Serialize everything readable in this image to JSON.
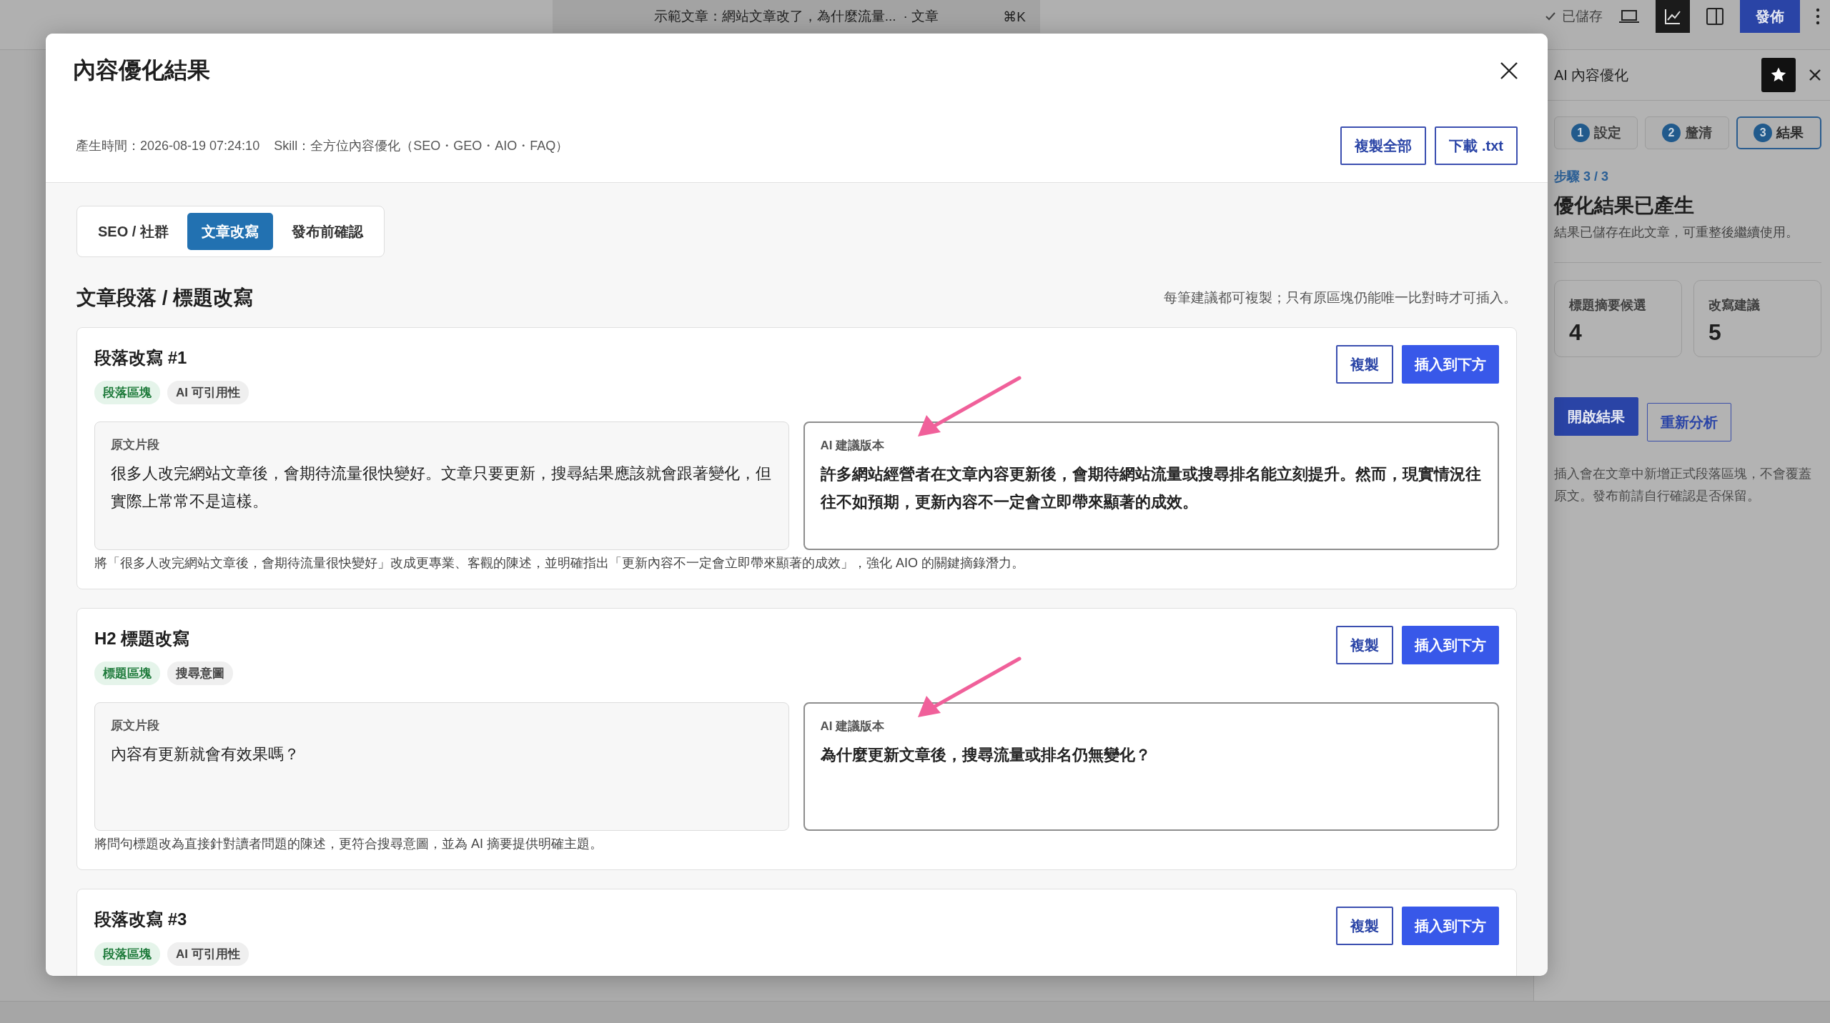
{
  "topbar": {
    "doc_title": "示範文章：網站文章改了，為什麼流量...",
    "doc_type": "· 文章",
    "shortcut": "⌘K",
    "saved": "已儲存",
    "publish": "發佈"
  },
  "sidebar": {
    "title": "AI 內容優化",
    "steps": [
      {
        "number": "1",
        "label": "設定",
        "selected": false
      },
      {
        "number": "2",
        "label": "釐清",
        "selected": false
      },
      {
        "number": "3",
        "label": "結果",
        "selected": true
      }
    ],
    "step_label": "步驟 3 / 3",
    "heading": "優化結果已產生",
    "subtext": "結果已儲存在此文章，可重整後繼續使用。",
    "stats": [
      {
        "label": "標題摘要候選",
        "value": "4"
      },
      {
        "label": "改寫建議",
        "value": "5"
      }
    ],
    "buttons": [
      {
        "label": "開啟結果",
        "kind": "primary"
      },
      {
        "label": "重新分析",
        "kind": "secondary"
      }
    ],
    "note": "插入會在文章中新增正式段落區塊，不會覆蓋原文。發布前請自行確認是否保留。"
  },
  "modal": {
    "title": "內容優化結果",
    "timestamp": "產生時間：2026-08-19 07:24:10",
    "skill": "Skill：全方位內容優化（SEO・GEO・AIO・FAQ）",
    "actions": [
      "複製全部",
      "下載 .txt"
    ],
    "tabs": [
      {
        "label": "SEO / 社群",
        "selected": false
      },
      {
        "label": "文章改寫",
        "selected": true
      },
      {
        "label": "發布前確認",
        "selected": false
      }
    ],
    "section_title": "文章段落 / 標題改寫",
    "section_note": "每筆建議都可複製；只有原區塊仍能唯一比對時才可插入。",
    "cards": [
      {
        "title": "段落改寫 #1",
        "tags": [
          {
            "label": "段落區塊",
            "kind": "block"
          },
          {
            "label": "AI 可引用性",
            "kind": "topic"
          }
        ],
        "copy": "複製",
        "insert": "插入到下方",
        "original_label": "原文片段",
        "original": "很多人改完網站文章後，會期待流量很快變好。文章只要更新，搜尋結果應該就會跟著變化，但實際上常常不是這樣。",
        "suggestion_label": "AI 建議版本",
        "suggestion": "許多網站經營者在文章內容更新後，會期待網站流量或搜尋排名能立刻提升。然而，現實情況往往不如預期，更新內容不一定會立即帶來顯著的成效。",
        "note": "將「很多人改完網站文章後，會期待流量很快變好」改成更專業、客觀的陳述，並明確指出「更新內容不一定會立即帶來顯著的成效」，強化 AIO 的關鍵摘錄潛力。",
        "arrow": true
      },
      {
        "title": "H2 標題改寫",
        "tags": [
          {
            "label": "標題區塊",
            "kind": "block"
          },
          {
            "label": "搜尋意圖",
            "kind": "topic"
          }
        ],
        "copy": "複製",
        "insert": "插入到下方",
        "original_label": "原文片段",
        "original": "內容有更新就會有效果嗎？",
        "suggestion_label": "AI 建議版本",
        "suggestion": "為什麼更新文章後，搜尋流量或排名仍無變化？",
        "note": "將問句標題改為直接針對讀者問題的陳述，更符合搜尋意圖，並為 AI 摘要提供明確主題。",
        "arrow": true
      },
      {
        "title": "段落改寫 #3",
        "tags": [
          {
            "label": "段落區塊",
            "kind": "block"
          },
          {
            "label": "AI 可引用性",
            "kind": "topic"
          }
        ],
        "copy": "複製",
        "insert": "插入到下方",
        "arrow": false
      }
    ]
  }
}
